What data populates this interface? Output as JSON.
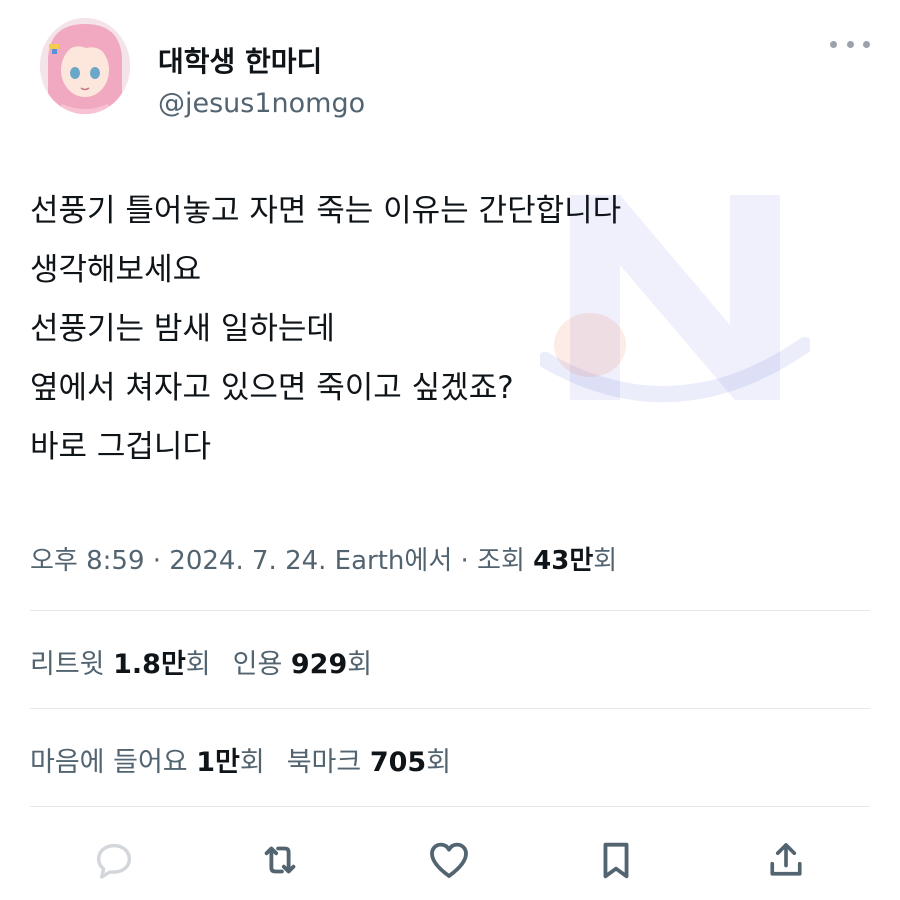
{
  "user": {
    "display_name": "대학생 한마디",
    "handle": "@jesus1nomgo",
    "avatar_icon": "anime-girl-pink-hair-avatar"
  },
  "tweet": {
    "lines": [
      "선풍기 틀어놓고 자면 죽는 이유는 간단합니다",
      "생각해보세요",
      "선풍기는 밤새 일하는데",
      "옆에서 쳐자고 있으면 죽이고 싶겠죠?",
      "바로 그겁니다"
    ]
  },
  "meta": {
    "time": "오후 8:59",
    "sep1": " · ",
    "date": "2024. 7. 24.",
    "source": " Earth에서",
    "sep2": " · ",
    "views_label": "조회 ",
    "views_value": "43만",
    "views_suffix": "회"
  },
  "stats1": {
    "retweets_label": "리트윗 ",
    "retweets_value": "1.8만",
    "retweets_suffix": "회",
    "quotes_label": "인용 ",
    "quotes_value": "929",
    "quotes_suffix": "회"
  },
  "stats2": {
    "likes_label": "마음에 들어요 ",
    "likes_value": "1만",
    "likes_suffix": "회",
    "bookmarks_label": "북마크 ",
    "bookmarks_value": "705",
    "bookmarks_suffix": "회"
  },
  "actions": {
    "icons": [
      "reply-icon",
      "retweet-icon",
      "like-icon",
      "bookmark-icon",
      "share-icon"
    ]
  },
  "colors": {
    "text": "#0f1419",
    "secondary": "#536471",
    "divider": "#e6e9ec",
    "watermark": "#4a5bd4"
  }
}
